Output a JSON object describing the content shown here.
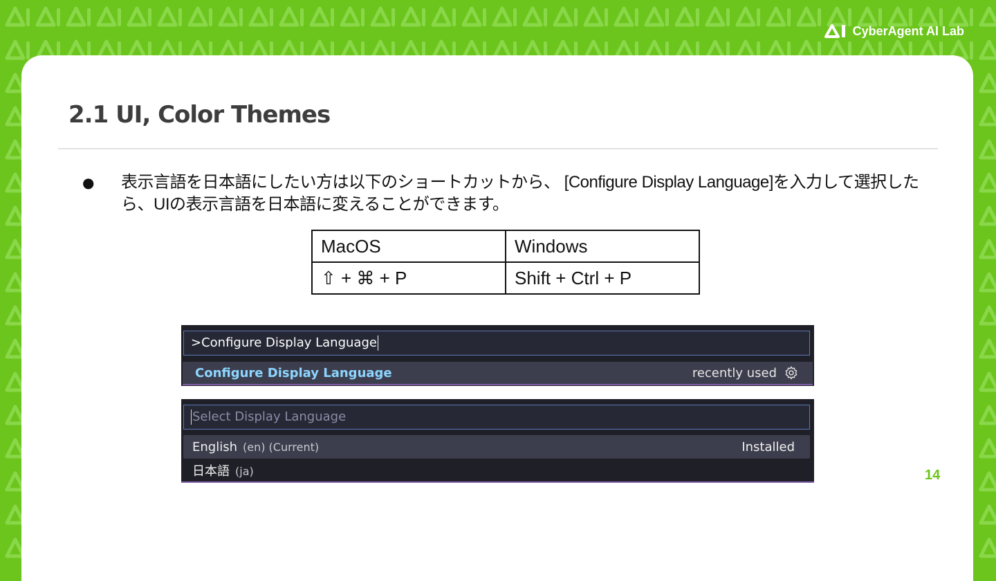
{
  "brand": {
    "name": "CyberAgent AI Lab",
    "logo_icon": "ai-logo-icon"
  },
  "slide": {
    "title": "2.1 UI, Color Themes",
    "bullet": "表示言語を日本語にしたい方は以下のショートカットから、 [Configure Display Language]を入力して選択したら、UIの表示言語を日本語に変えることができます。",
    "page_number": "14"
  },
  "shortcut_table": {
    "headers": [
      "MacOS",
      "Windows"
    ],
    "rows": [
      [
        "⇧ + ⌘ + P",
        "Shift + Ctrl + P"
      ]
    ]
  },
  "command_palette": {
    "input_value": ">Configure Display Language",
    "result_label": "Configure Display Language",
    "result_hint": "recently used",
    "result_icon": "gear-icon"
  },
  "language_picker": {
    "placeholder": "Select Display Language",
    "options": [
      {
        "name": "English",
        "detail": "(en) (Current)",
        "status": "Installed"
      },
      {
        "name": "日本語",
        "detail": "(ja)",
        "status": ""
      }
    ]
  },
  "colors": {
    "brand_green": "#6cc51c",
    "palette_bg": "#1f1f27",
    "highlight_blue": "#8cd6ff"
  }
}
